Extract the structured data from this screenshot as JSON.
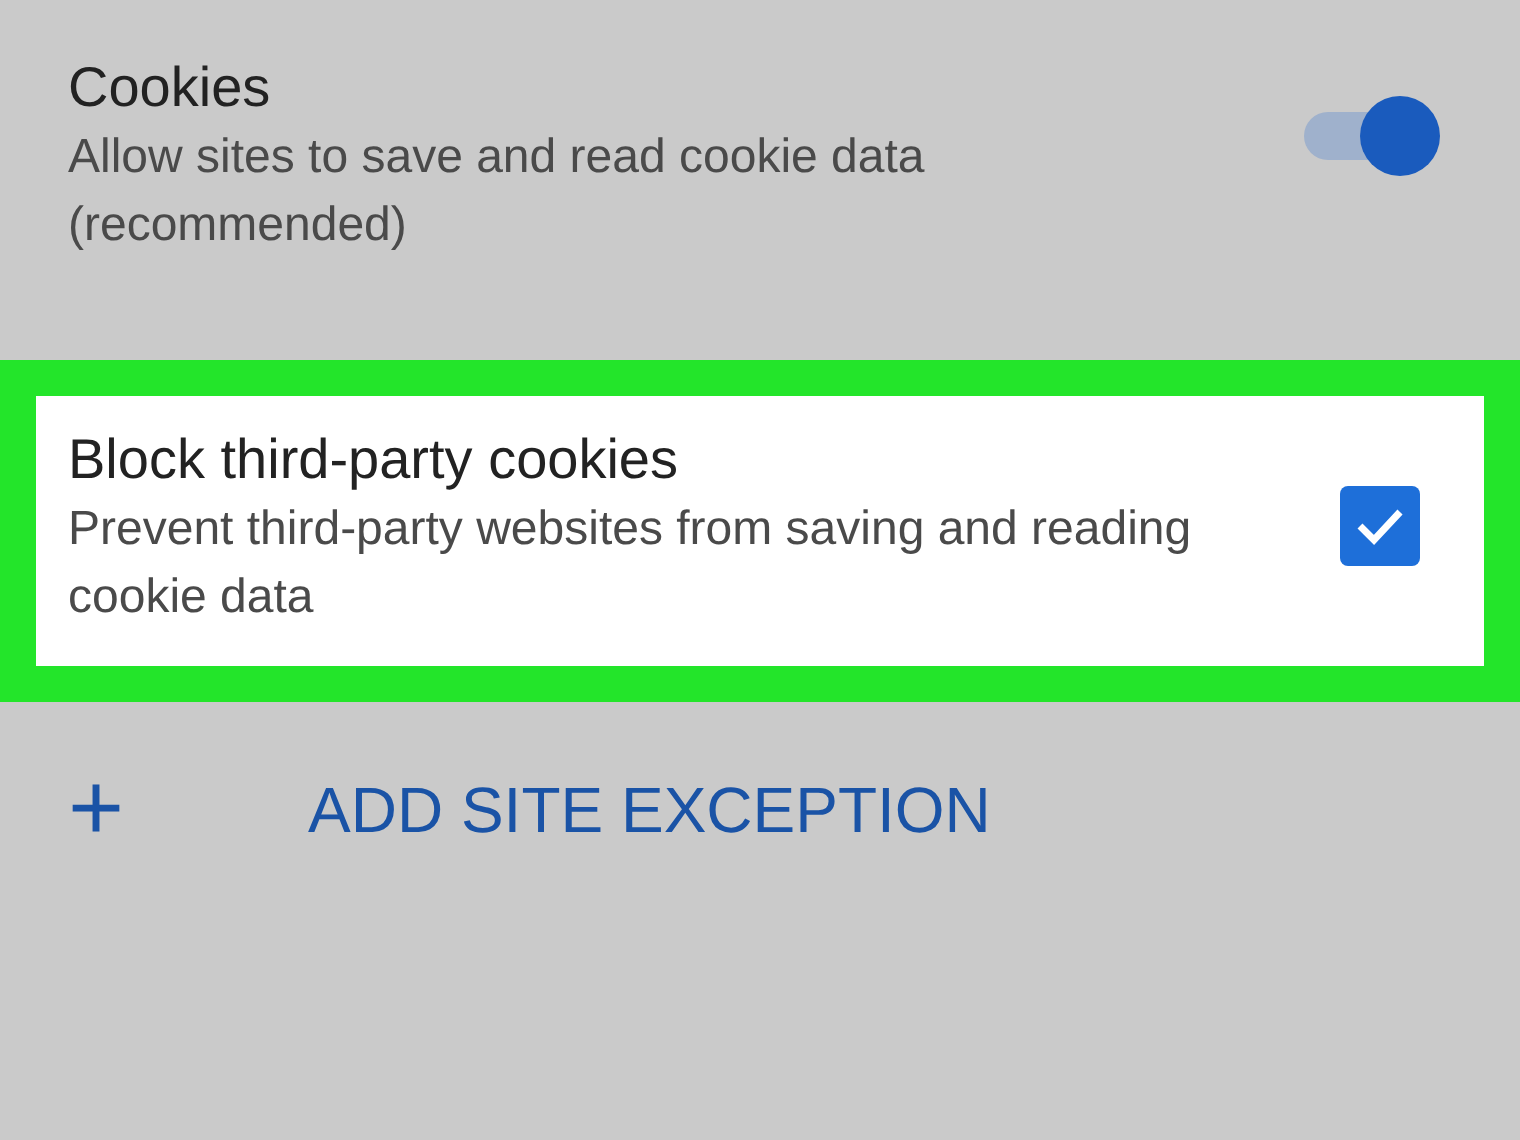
{
  "settings": [
    {
      "kind": "toggle",
      "title": "Cookies",
      "description": "Allow sites to save and read cookie data (recommended)",
      "on": true
    },
    {
      "kind": "checkbox",
      "title": "Block third-party cookies",
      "description": "Prevent third-party websites from saving and reading cookie data",
      "checked": true,
      "highlighted": true
    }
  ],
  "add_exception": {
    "icon": "+",
    "label": "ADD SITE EXCEPTION"
  }
}
